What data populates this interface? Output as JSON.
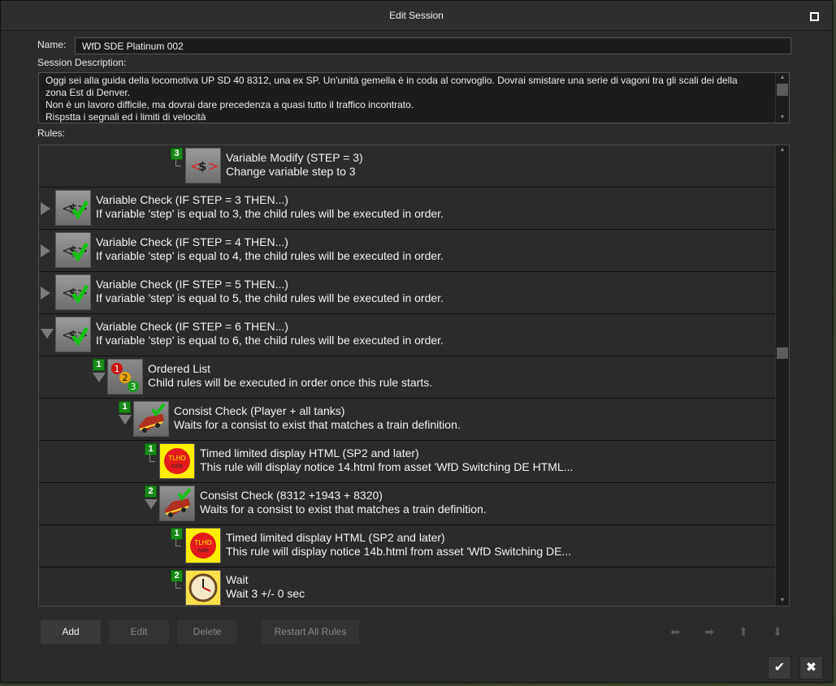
{
  "window": {
    "title": "Edit Session"
  },
  "fields": {
    "name_label": "Name:",
    "name_value": "WfD SDE Platinum 002",
    "description_label": "Session Description:",
    "description_lines": [
      "Oggi sei alla guida della locomotiva UP SD 40 8312, una ex SP. Un'unità gemella è in coda al convoglio. Dovrai smistare una serie di vagoni tra gli scali dei della",
      "zona Est di Denver.",
      "Non è un lavoro difficile, ma dovrai dare precedenza a quasi tutto il traffico incontrato.",
      "Rispstta i segnali ed i limiti di velocità"
    ],
    "rules_label": "Rules:"
  },
  "rules": [
    {
      "title": "Variable Modify  (STEP = 3)",
      "desc": "Change variable step to 3",
      "icon": "variable-modify-icon",
      "badge": "3",
      "expander": "",
      "name": "rule-variable-modify"
    },
    {
      "title": "Variable Check  (IF STEP = 3  THEN...)",
      "desc": "If variable 'step' is equal to 3, the child rules will be executed in order.",
      "icon": "variable-check-icon",
      "badge": "",
      "expander": "collapsed",
      "name": "rule-variable-check-3"
    },
    {
      "title": "Variable Check  (IF STEP = 4 THEN...)",
      "desc": "If variable 'step' is equal to 4, the child rules will be executed in order.",
      "icon": "variable-check-icon",
      "badge": "",
      "expander": "collapsed",
      "name": "rule-variable-check-4"
    },
    {
      "title": "Variable Check  (IF STEP = 5 THEN...)",
      "desc": "If variable 'step' is equal to 5, the child rules will be executed in order.",
      "icon": "variable-check-icon",
      "badge": "",
      "expander": "collapsed",
      "name": "rule-variable-check-5"
    },
    {
      "title": "Variable Check  (IF STEP = 6 THEN...)",
      "desc": "If variable 'step' is equal to 6, the child rules will be executed in order.",
      "icon": "variable-check-icon",
      "badge": "",
      "expander": "expanded",
      "name": "rule-variable-check-6"
    },
    {
      "title": "Ordered List",
      "desc": "Child rules will be executed in order once this rule starts.",
      "icon": "ordered-list-icon",
      "badge": "1",
      "expander": "expanded",
      "name": "rule-ordered-list"
    },
    {
      "title": "Consist Check  (Player + all tanks)",
      "desc": "Waits for a consist to exist that matches a train definition.",
      "icon": "consist-check-icon",
      "badge": "1",
      "expander": "expanded",
      "name": "rule-consist-check-player"
    },
    {
      "title": "Timed limited display HTML (SP2 and later)",
      "desc": "This rule will display notice 14.html from asset 'WfD Switching DE HTML...",
      "icon": "html-display-icon",
      "badge": "1",
      "expander": "",
      "name": "rule-html-display-14"
    },
    {
      "title": "Consist Check  (8312 +1943 + 8320)",
      "desc": "Waits for a consist to exist that matches a train definition.",
      "icon": "consist-check-icon",
      "badge": "2",
      "expander": "expanded",
      "name": "rule-consist-check-8312"
    },
    {
      "title": "Timed limited display HTML (SP2 and later)",
      "desc": "This rule will display notice 14b.html from asset 'WfD Switching DE...",
      "icon": "html-display-icon",
      "badge": "1",
      "expander": "",
      "name": "rule-html-display-14b"
    },
    {
      "title": "Wait",
      "desc": "Wait 3 +/- 0 sec",
      "icon": "clock-icon",
      "badge": "2",
      "expander": "",
      "name": "rule-wait"
    }
  ],
  "buttons": {
    "add": "Add",
    "edit": "Edit",
    "delete": "Delete",
    "restart": "Restart All Rules"
  },
  "icons": {
    "tlhd_line1": "TLHD",
    "tlhd_line2": "rule"
  }
}
